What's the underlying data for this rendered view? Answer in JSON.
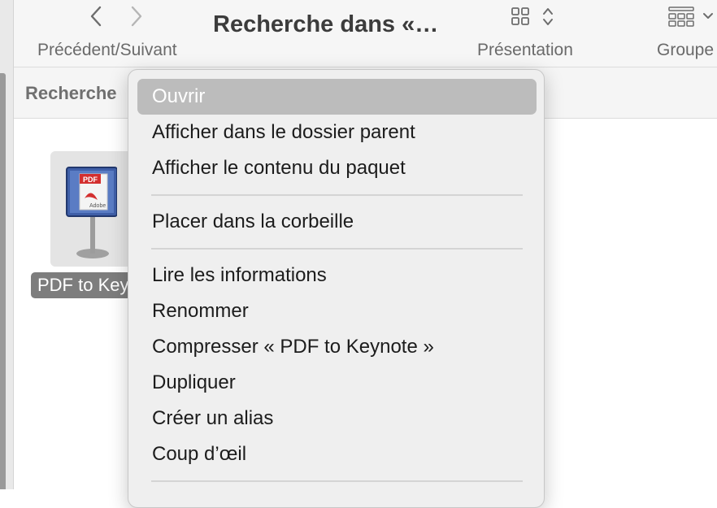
{
  "toolbar": {
    "nav_label": "Précédent/Suivant",
    "window_title": "Recherche dans «…",
    "view_label": "Présentation",
    "group_label": "Groupe"
  },
  "search": {
    "label": "Recherche"
  },
  "file": {
    "name": "PDF to Keynote"
  },
  "context_menu": {
    "items": [
      "Ouvrir",
      "Afficher dans le dossier parent",
      "Afficher le contenu du paquet",
      "Placer dans la corbeille",
      "Lire les informations",
      "Renommer",
      "Compresser « PDF to Keynote »",
      "Dupliquer",
      "Créer un alias",
      "Coup d’œil"
    ],
    "highlighted_index": 0
  },
  "icons": {
    "back": "chevron-left-icon",
    "forward": "chevron-right-icon",
    "view": "grid-view-icon",
    "group": "group-by-icon",
    "app": "pdf-to-keynote-app-icon"
  },
  "colors": {
    "highlight": "#bcbcbc",
    "menu_background": "#efefef",
    "selection_label": "#7d7d7d"
  }
}
